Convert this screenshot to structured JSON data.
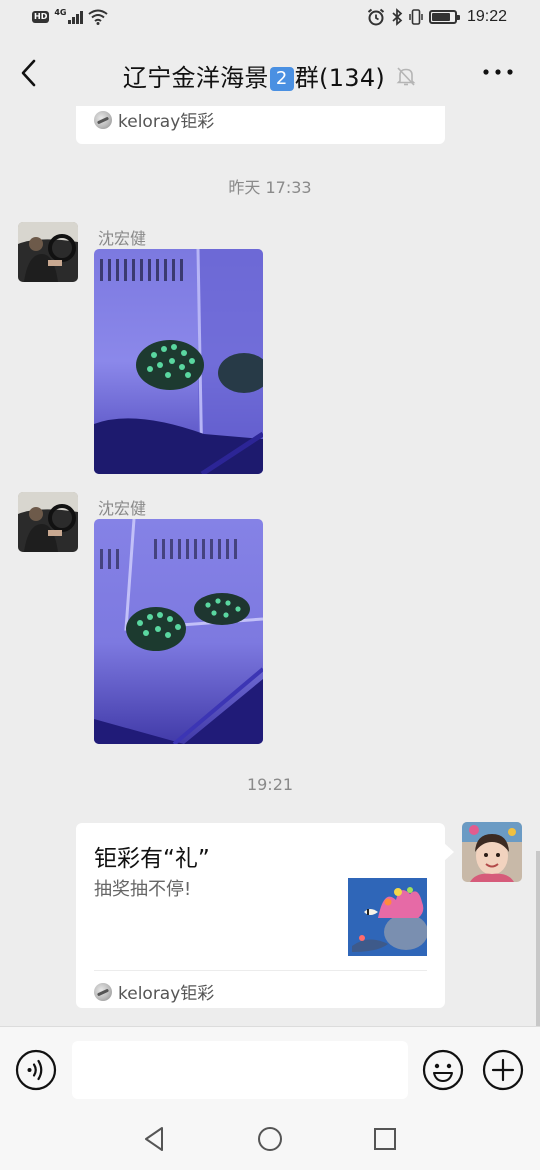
{
  "status_bar": {
    "hd": "HD",
    "network": "4G",
    "time": "19:22",
    "battery_level": 0.8
  },
  "header": {
    "title_prefix": "辽宁金洋海景",
    "title_badge": "2",
    "title_suffix": "群(134)"
  },
  "messages": {
    "top_card": {
      "source": "keloray钜彩"
    },
    "timestamp_1": "昨天 17:33",
    "photo_msg_1": {
      "sender": "沈宏健"
    },
    "photo_msg_2": {
      "sender": "沈宏健"
    },
    "timestamp_2": "19:21",
    "link_card": {
      "title": "钜彩有“礼”",
      "description": "抽奖抽不停!",
      "source": "keloray钜彩"
    }
  },
  "input": {
    "placeholder": ""
  },
  "icons": {
    "back": "back-arrow-icon",
    "mute": "bell-muted-icon",
    "more": "more-dots-icon",
    "voice": "voice-icon",
    "emoji": "emoji-icon",
    "plus": "plus-icon"
  },
  "colors": {
    "background": "#ededed",
    "accent_tank": "#5a52c9"
  }
}
